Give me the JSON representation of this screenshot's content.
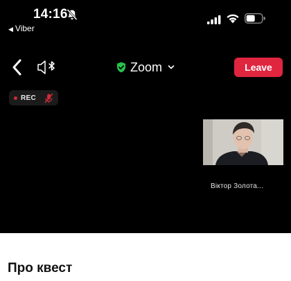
{
  "status_bar": {
    "time": "14:16",
    "back_app": "Viber",
    "icons": [
      "bell-slash-icon",
      "cellular-signal-icon",
      "wifi-icon",
      "battery-icon"
    ]
  },
  "header": {
    "meeting_title": "Zoom",
    "leave_label": "Leave",
    "leave_color": "#e0253f",
    "shield_color": "#27c24c"
  },
  "video": {
    "rec_label": "REC",
    "participant_name": "Віктор Золота..."
  },
  "sheet": {
    "title": "Про квест"
  }
}
